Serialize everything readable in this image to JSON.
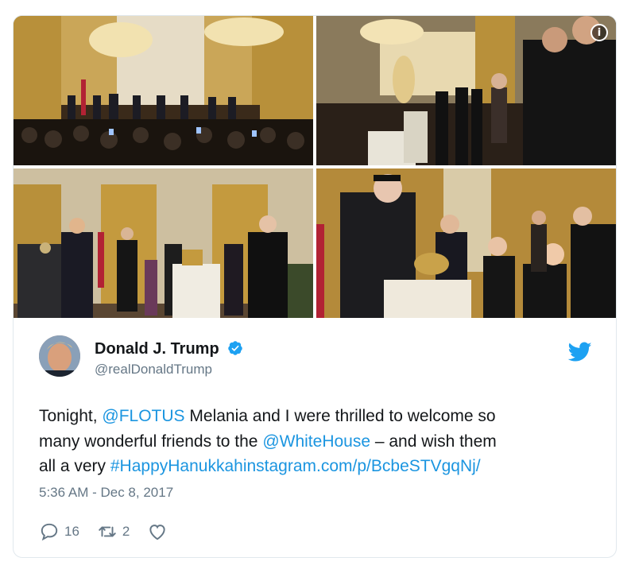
{
  "tweet": {
    "display_name": "Donald J. Trump",
    "handle": "@realDonaldTrump",
    "text": {
      "l1_a": "Tonight, ",
      "l1_link": "@FLOTUS",
      "l1_b": " Melania and I were thrilled to welcome so",
      "l2_a": "many wonderful friends to the ",
      "l2_link": "@WhiteHouse",
      "l2_b": " – and wish them",
      "l3_a": "all a very ",
      "l3_link": "#HappyHanukkahinstagram.com/p/BcbeSTVgqNj/"
    },
    "timestamp": "5:36 AM - Dec 8, 2017",
    "replies": "16",
    "retweets": "2",
    "likes": ""
  },
  "icons": {
    "verified": "verified-badge-icon",
    "bird": "twitter-bird-icon",
    "info": "info-icon",
    "reply": "reply-icon",
    "retweet": "retweet-icon",
    "like": "heart-icon"
  },
  "colors": {
    "link": "#1b95e0",
    "muted": "#657786",
    "text": "#14171a",
    "border": "#e1e8ed"
  },
  "media": {
    "info_glyph": "i"
  }
}
